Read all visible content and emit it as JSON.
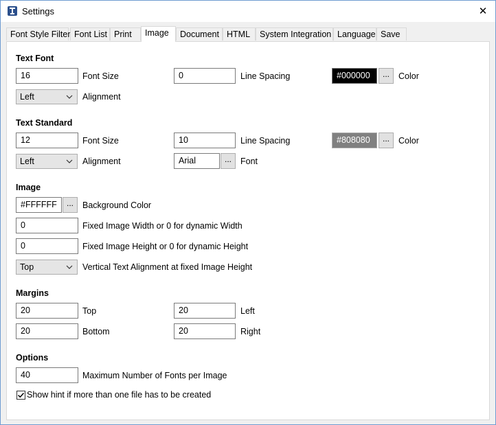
{
  "window": {
    "title": "Settings",
    "close_glyph": "✕"
  },
  "tabs": [
    {
      "label": "Font Style Filter"
    },
    {
      "label": "Font List"
    },
    {
      "label": "Print"
    },
    {
      "label": "Image"
    },
    {
      "label": "Document"
    },
    {
      "label": "HTML"
    },
    {
      "label": "System Integration"
    },
    {
      "label": "Language"
    },
    {
      "label": "Save"
    }
  ],
  "active_tab": "Image",
  "text_font": {
    "heading": "Text Font",
    "font_size": "16",
    "font_size_label": "Font Size",
    "line_spacing": "0",
    "line_spacing_label": "Line Spacing",
    "color": "#000000",
    "color_label": "Color",
    "color_button": "...",
    "alignment": "Left",
    "alignment_label": "Alignment"
  },
  "text_standard": {
    "heading": "Text Standard",
    "font_size": "12",
    "font_size_label": "Font Size",
    "line_spacing": "10",
    "line_spacing_label": "Line Spacing",
    "color": "#808080",
    "color_label": "Color",
    "color_button": "...",
    "alignment": "Left",
    "alignment_label": "Alignment",
    "font": "Arial",
    "font_label": "Font",
    "font_button": "..."
  },
  "image": {
    "heading": "Image",
    "background_color": "#FFFFFF",
    "background_button": "...",
    "background_label": "Background Color",
    "fixed_width": "0",
    "fixed_width_label": "Fixed Image Width or 0 for dynamic Width",
    "fixed_height": "0",
    "fixed_height_label": "Fixed Image Height or 0 for dynamic Height",
    "vertical_alignment": "Top",
    "vertical_alignment_label": "Vertical Text Alignment at fixed Image Height"
  },
  "margins": {
    "heading": "Margins",
    "top": "20",
    "top_label": "Top",
    "left": "20",
    "left_label": "Left",
    "bottom": "20",
    "bottom_label": "Bottom",
    "right": "20",
    "right_label": "Right"
  },
  "options": {
    "heading": "Options",
    "max_fonts": "40",
    "max_fonts_label": "Maximum Number of Fonts per Image",
    "hint_checked": true,
    "hint_label": "Show hint if more than one file has to be created"
  },
  "colors": {
    "accent_border": "#6e9bd1",
    "panel_bg": "#ffffff",
    "window_bg": "#f0f0f0"
  },
  "icons": {
    "app": "app-logo-icon",
    "close": "close-icon",
    "dropdown": "chevron-down-icon",
    "check": "checkmark-icon"
  }
}
